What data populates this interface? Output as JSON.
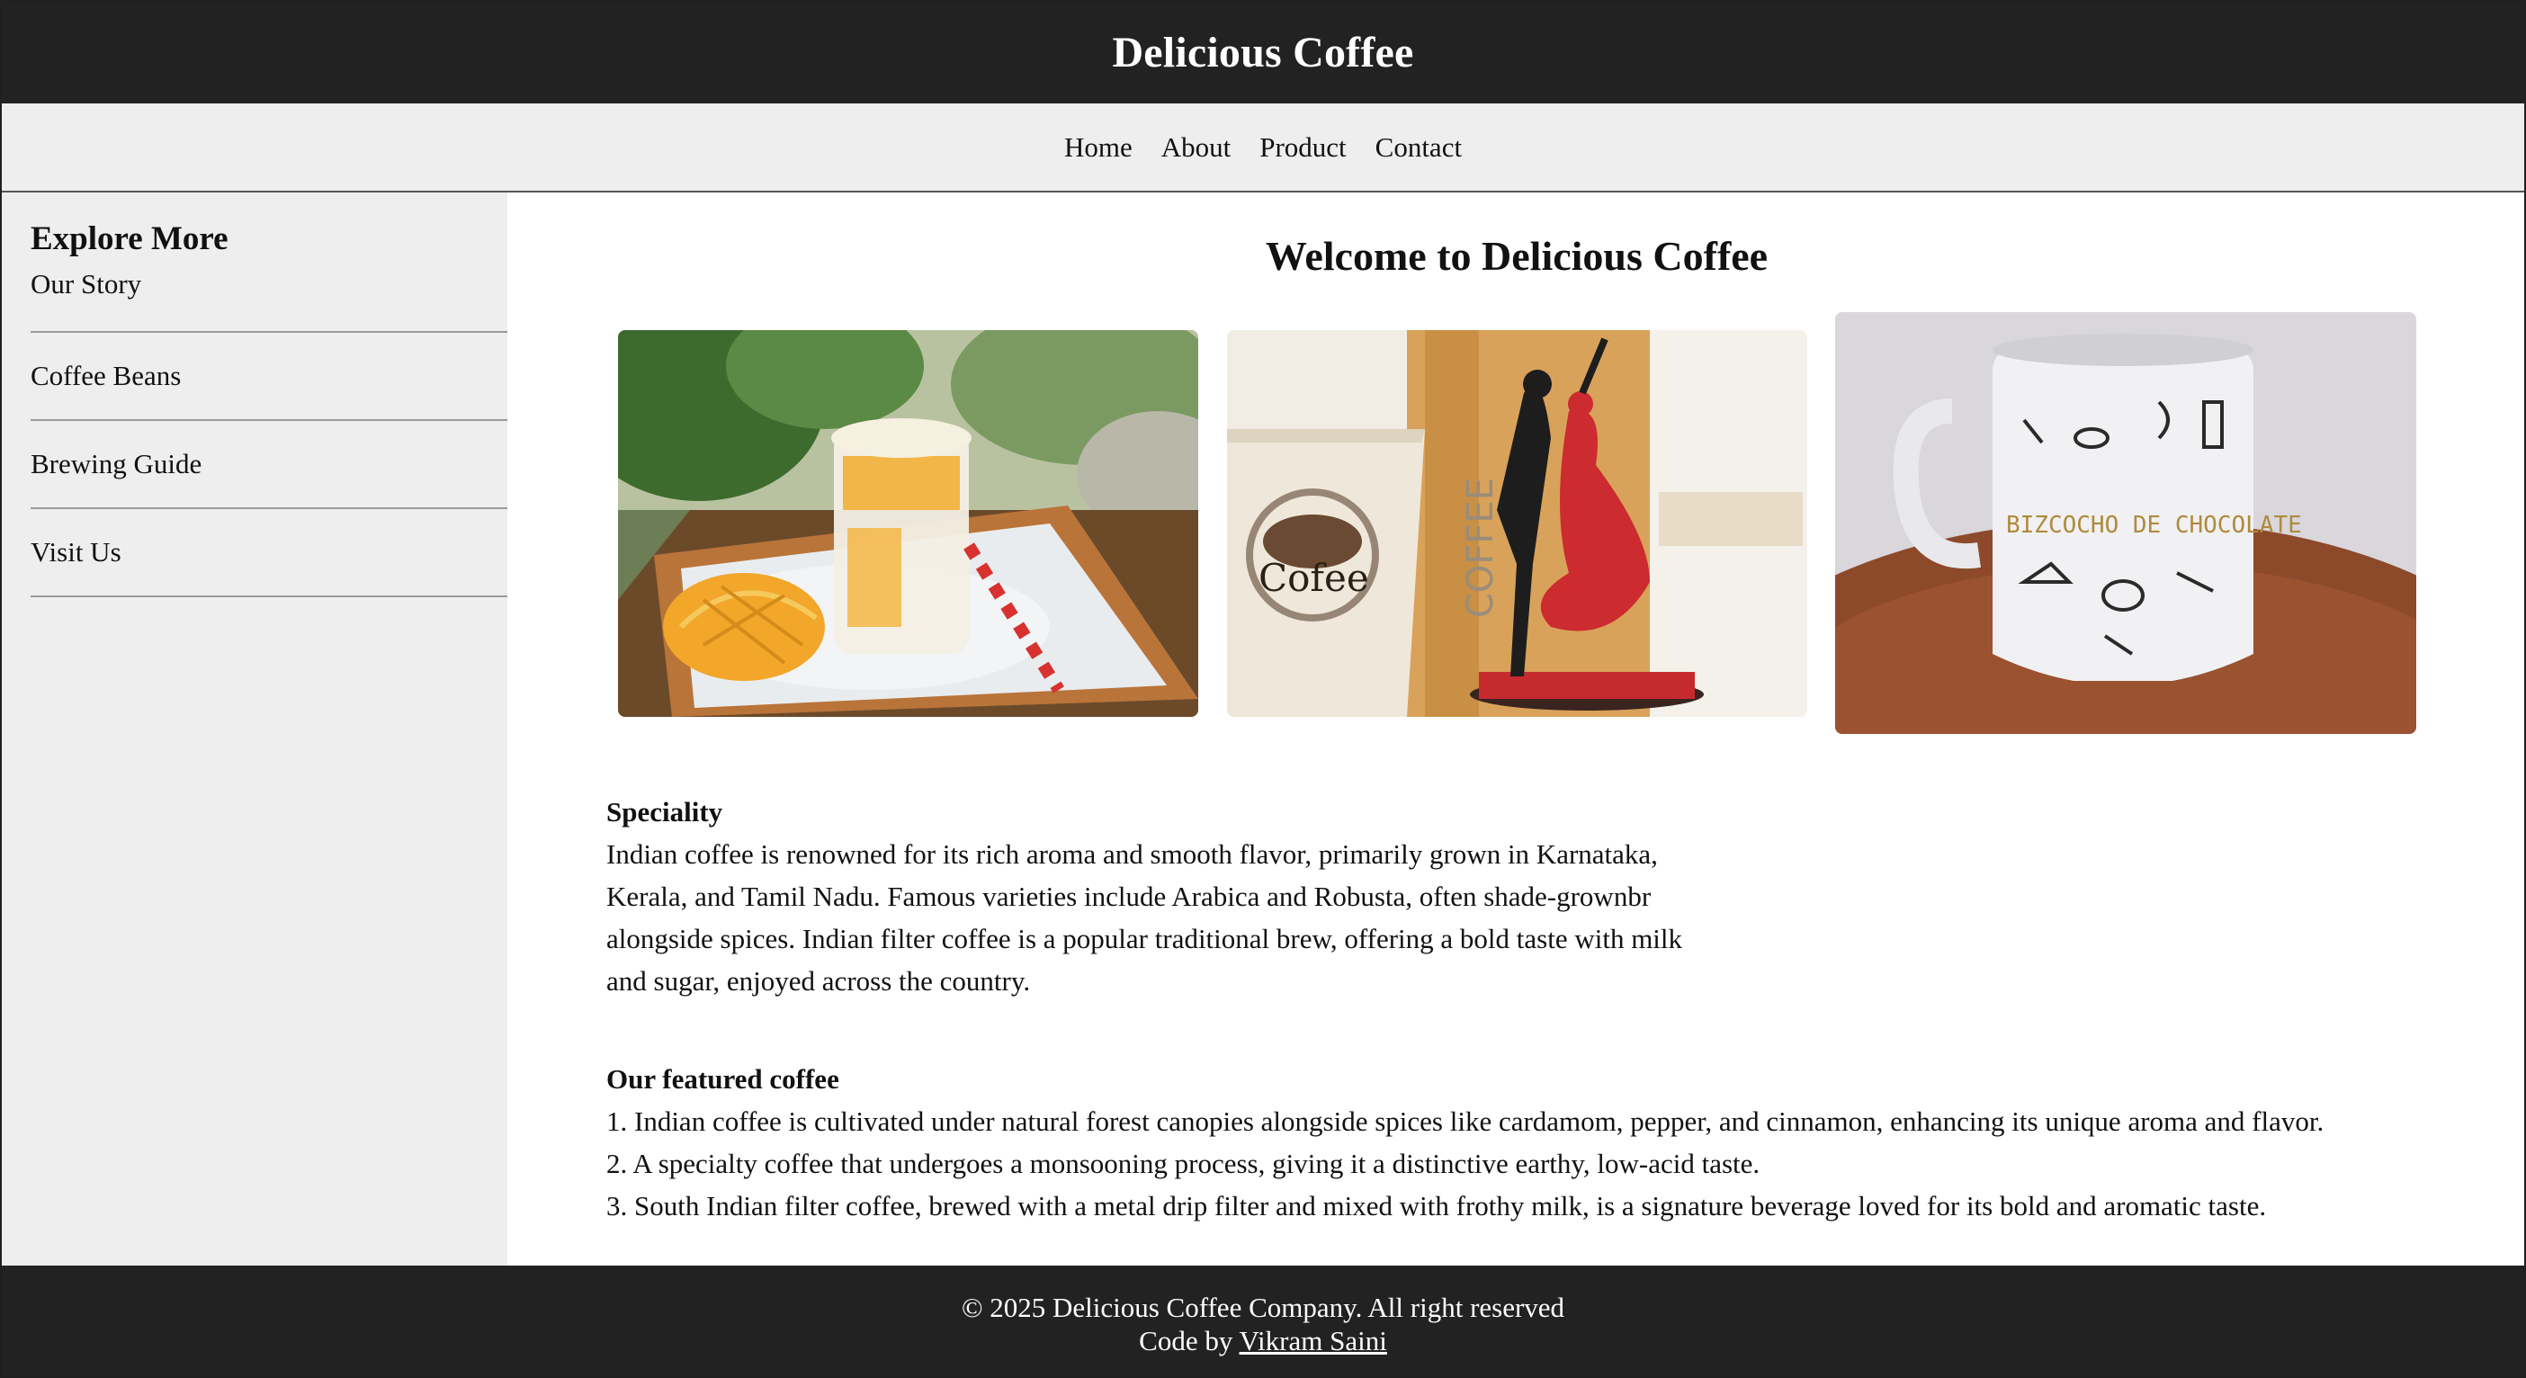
{
  "header": {
    "title": "Delicious Coffee"
  },
  "nav": {
    "items": [
      {
        "label": "Home"
      },
      {
        "label": "About"
      },
      {
        "label": "Product"
      },
      {
        "label": "Contact"
      }
    ]
  },
  "sidebar": {
    "title": "Explore More",
    "items": [
      {
        "label": "Our Story"
      },
      {
        "label": "Coffee Beans"
      },
      {
        "label": "Brewing Guide"
      },
      {
        "label": "Visit Us"
      }
    ]
  },
  "main": {
    "title": "Welcome to Delicious Coffee",
    "gallery": [
      {
        "subject": "mango-milkshake-photo"
      },
      {
        "subject": "coffee-cup-dancer-figurine-photo"
      },
      {
        "subject": "mug-in-cocoa-powder-photo",
        "mug_text": "BIZCOCHO DE CHOCOLATE"
      }
    ],
    "speciality": {
      "heading": "Speciality",
      "text": "Indian coffee is renowned for its rich aroma and smooth flavor, primarily grown in Karnataka, Kerala, and Tamil Nadu. Famous varieties include Arabica and Robusta, often shade-grownbr alongside spices. Indian filter coffee is a popular traditional brew, offering a bold taste with milk and sugar, enjoyed across the country."
    },
    "featured": {
      "heading": "Our featured coffee",
      "items": [
        "1. Indian coffee is cultivated under natural forest canopies alongside spices like cardamom, pepper, and cinnamon, enhancing its unique aroma and flavor.",
        "2. A specialty coffee that undergoes a monsooning process, giving it a distinctive earthy, low-acid taste.",
        "3. South Indian filter coffee, brewed with a metal drip filter and mixed with frothy milk, is a signature beverage loved for its bold and aromatic taste."
      ]
    }
  },
  "footer": {
    "copyright": "© 2025 Delicious Coffee Company. All right reserved",
    "credit_prefix": "Code by ",
    "credit_name": "Vikram Saini"
  },
  "colors": {
    "header_bg": "#222222",
    "nav_bg": "#eeeeee",
    "sidebar_bg": "#eeeeee",
    "footer_bg": "#222222"
  }
}
